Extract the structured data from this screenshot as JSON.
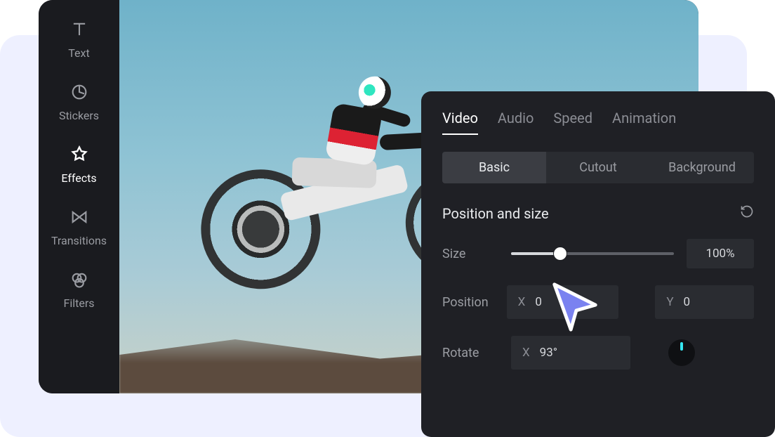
{
  "sidebar": {
    "items": [
      {
        "label": "Text",
        "icon": "text-icon"
      },
      {
        "label": "Stickers",
        "icon": "stickers-icon"
      },
      {
        "label": "Effects",
        "icon": "effects-icon",
        "active": true
      },
      {
        "label": "Transitions",
        "icon": "transitions-icon"
      },
      {
        "label": "Filters",
        "icon": "filters-icon"
      }
    ]
  },
  "panel": {
    "tabs": [
      "Video",
      "Audio",
      "Speed",
      "Animation"
    ],
    "activeTab": "Video",
    "subtabs": [
      "Basic",
      "Cutout",
      "Background"
    ],
    "activeSubtab": "Basic",
    "section": "Position and size",
    "size": {
      "label": "Size",
      "value": "100%",
      "percent": 30
    },
    "position": {
      "label": "Position",
      "x": "0",
      "y": "0"
    },
    "rotate": {
      "label": "Rotate",
      "x": "93°"
    }
  },
  "colors": {
    "accentCursor": "#7a82f0"
  }
}
